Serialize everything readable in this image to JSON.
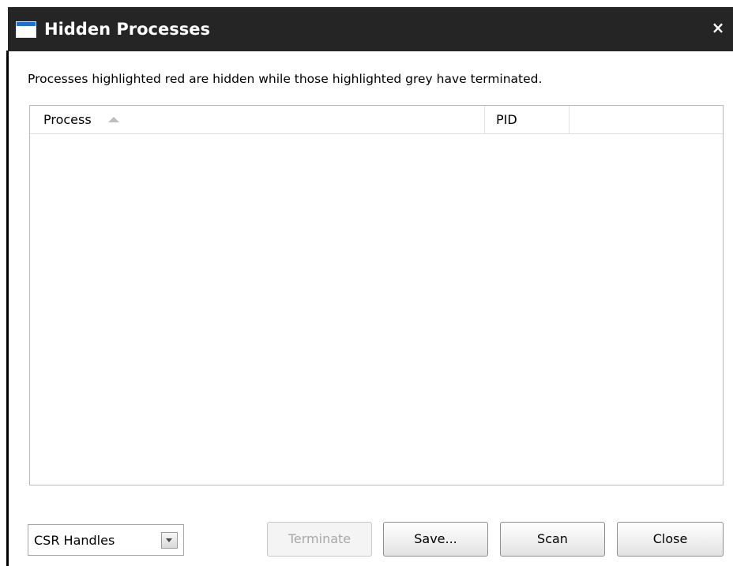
{
  "window": {
    "title": "Hidden Processes",
    "close_glyph": "×",
    "title_icon": "window-icon"
  },
  "description": "Processes highlighted red are hidden while those highlighted grey have terminated.",
  "list": {
    "columns": [
      {
        "label": "Process",
        "sorted": "ascending"
      },
      {
        "label": "PID"
      },
      {
        "label": ""
      }
    ],
    "rows": []
  },
  "filter": {
    "selected": "CSR Handles"
  },
  "buttons": {
    "terminate": {
      "label": "Terminate",
      "enabled": false
    },
    "save": {
      "label": "Save..."
    },
    "scan": {
      "label": "Scan"
    },
    "close": {
      "label": "Close"
    }
  },
  "colors": {
    "titlebar": "#252525",
    "title_text": "#ffffff",
    "accent_icon": "#1e6fd2",
    "header_divider": "#cfe0f1"
  }
}
